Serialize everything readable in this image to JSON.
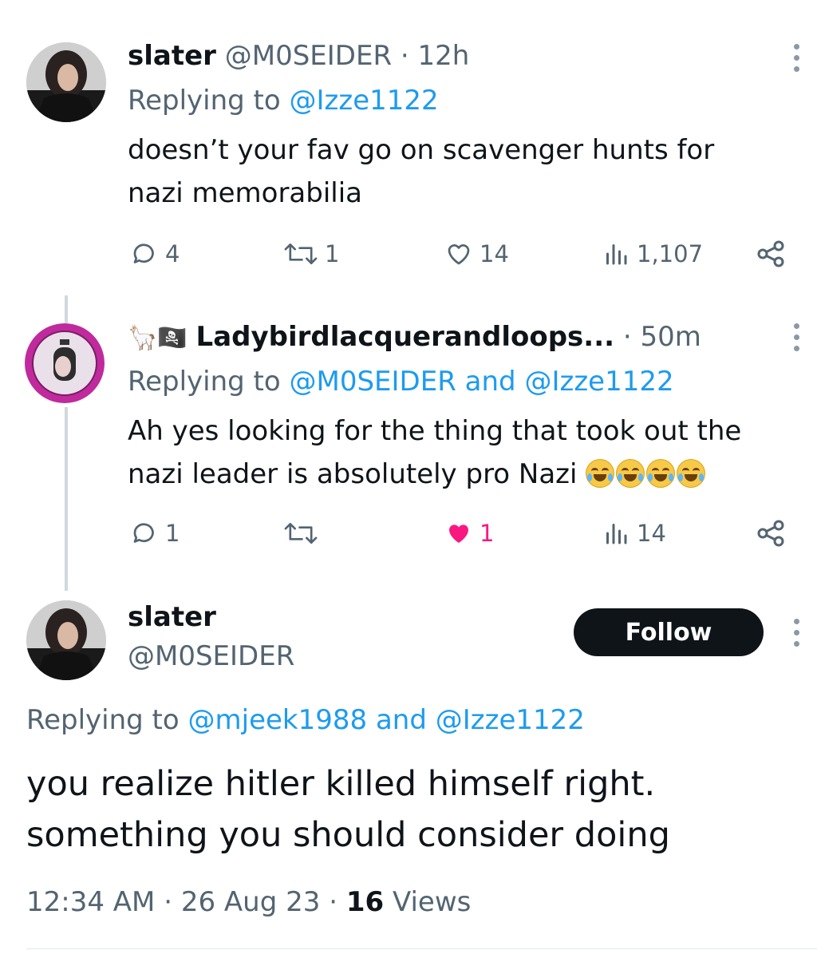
{
  "tweet1": {
    "display_name": "slater",
    "handle": "@M0SEIDER",
    "sep": "·",
    "time": "12h",
    "replying_prefix": "Replying to",
    "replying_to": "@Izze1122",
    "text_line1": "doesn’t your fav go on scavenger hunts for",
    "text_line2": "nazi memorabilia",
    "replies": "4",
    "retweets": "1",
    "likes": "14",
    "views": "1,107"
  },
  "tweet2": {
    "emoji_prefix": "🦙🏴‍☠️",
    "display_name": "Ladybirdlacquerandloops...",
    "sep": "·",
    "time": "50m",
    "replying_prefix": "Replying to",
    "replying_to_1": "@M0SEIDER",
    "replying_and": "and",
    "replying_to_2": "@Izze1122",
    "text_line1": "Ah yes looking for the thing that took out the",
    "text_line2": "nazi leader is absolutely pro Nazi",
    "replies": "1",
    "retweets": "",
    "likes": "1",
    "views": "14",
    "like_color": "#f91880"
  },
  "tweet3": {
    "display_name": "slater",
    "handle": "@M0SEIDER",
    "follow_label": "Follow",
    "replying_prefix": "Replying to",
    "replying_to_1": "@mjeek1988",
    "replying_and": "and",
    "replying_to_2": "@Izze1122",
    "text_line1": "you realize hitler killed himself right.",
    "text_line2": "something you should consider doing",
    "time": "12:34 AM",
    "sep1": "·",
    "date": "26 Aug 23",
    "sep2": "·",
    "views_count": "16",
    "views_label": "Views"
  },
  "colors": {
    "text": "#0f1419",
    "secondary": "#536471",
    "link": "#1d9bf0",
    "like_active": "#f91880",
    "button_bg": "#0f1419"
  }
}
